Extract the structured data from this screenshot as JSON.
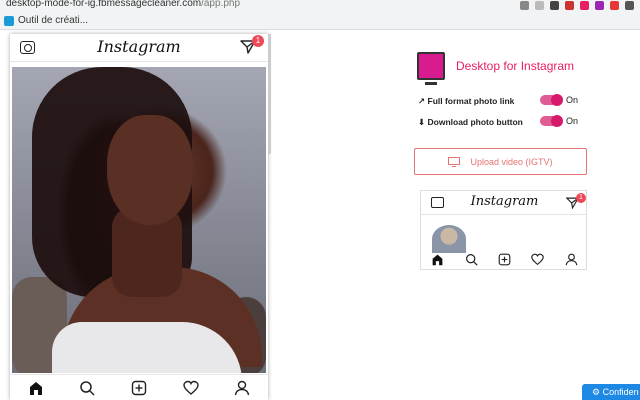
{
  "browser": {
    "url_host": "desktop-mode-for-ig.fbmessagecleaner.com",
    "url_path": "/app.php",
    "bookmark_label": "Outil de créati..."
  },
  "phone": {
    "brand": "Instagram",
    "badge_count": "1",
    "icons": [
      "camera-icon",
      "send-icon",
      "home-icon",
      "search-icon",
      "add-icon",
      "heart-icon",
      "profile-icon"
    ]
  },
  "panel": {
    "title": "Desktop for Instagram",
    "options": [
      {
        "label": "Full format photo link",
        "state": "On",
        "enabled": true
      },
      {
        "label": "Download photo button",
        "state": "On",
        "enabled": true
      }
    ],
    "upload_label": "Upload video (IGTV)",
    "preview": {
      "brand": "Instagram",
      "badge_count": "1"
    }
  },
  "footer": {
    "confid_label": "Confiden"
  },
  "colors": {
    "accent": "#e91e63",
    "toggle": "#d6196b",
    "badge": "#ed4956",
    "upload": "#e57373",
    "confid": "#1e88e5"
  }
}
